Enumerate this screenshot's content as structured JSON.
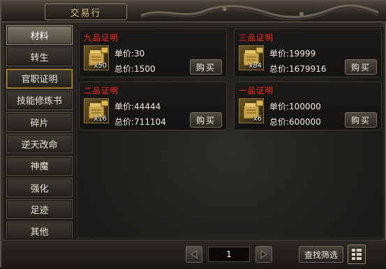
{
  "window": {
    "title": "交易行"
  },
  "sidebar": {
    "items": [
      {
        "label": "材料",
        "state": "active"
      },
      {
        "label": "转生",
        "state": "normal"
      },
      {
        "label": "官职证明",
        "state": "hover"
      },
      {
        "label": "技能修炼书",
        "state": "normal"
      },
      {
        "label": "碎片",
        "state": "normal"
      },
      {
        "label": "逆天改命",
        "state": "normal"
      },
      {
        "label": "神魔",
        "state": "normal"
      },
      {
        "label": "强化",
        "state": "normal"
      },
      {
        "label": "足迹",
        "state": "normal"
      },
      {
        "label": "其他",
        "state": "normal"
      }
    ]
  },
  "listings": [
    {
      "name": "九品证明",
      "count": "x50",
      "unit_label": "单价:",
      "unit_price": "30",
      "total_label": "总价:",
      "total_price": "1500",
      "buy_label": "购买",
      "icon": "scroll-certificate-icon"
    },
    {
      "name": "三品证明",
      "count": "x84",
      "unit_label": "单价:",
      "unit_price": "19999",
      "total_label": "总价:",
      "total_price": "1679916",
      "buy_label": "购买",
      "icon": "scroll-certificate-icon"
    },
    {
      "name": "二品证明",
      "count": "x16",
      "unit_label": "单价:",
      "unit_price": "44444",
      "total_label": "总价:",
      "total_price": "711104",
      "buy_label": "购买",
      "icon": "scroll-certificate-icon"
    },
    {
      "name": "一品证明",
      "count": "x6",
      "unit_label": "单价:",
      "unit_price": "100000",
      "total_label": "总价:",
      "total_price": "600000",
      "buy_label": "购买",
      "icon": "scroll-certificate-icon"
    }
  ],
  "pagination": {
    "current_page": "1",
    "prev_icon": "triangle-left-icon",
    "next_icon": "triangle-right-icon"
  },
  "toolbar": {
    "filter_label": "查找筛选",
    "layout_icon": "list-layout-icon"
  },
  "colors": {
    "item_name": "#ff2a1e",
    "title_gold": "#e7c98a",
    "text": "#f2ece0"
  }
}
